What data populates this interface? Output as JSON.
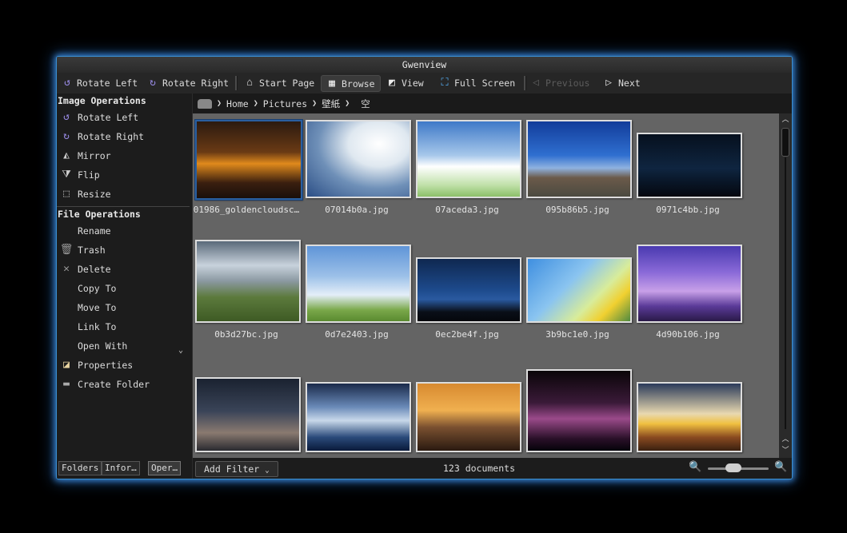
{
  "window": {
    "title": "Gwenview"
  },
  "toolbar": {
    "rotate_left": "Rotate Left",
    "rotate_right": "Rotate Right",
    "start_page": "Start Page",
    "browse": "Browse",
    "view": "View",
    "full_screen": "Full Screen",
    "previous": "Previous",
    "next": "Next"
  },
  "sidebar": {
    "image_ops_title": "Image Operations",
    "image_ops": [
      {
        "label": "Rotate Left",
        "icon": "rotate-left-icon"
      },
      {
        "label": "Rotate Right",
        "icon": "rotate-right-icon"
      },
      {
        "label": "Mirror",
        "icon": "mirror-icon"
      },
      {
        "label": "Flip",
        "icon": "flip-icon"
      },
      {
        "label": "Resize",
        "icon": "resize-icon"
      }
    ],
    "file_ops_title": "File Operations",
    "file_ops": [
      {
        "label": "Rename",
        "icon": ""
      },
      {
        "label": "Trash",
        "icon": "trash-icon"
      },
      {
        "label": "Delete",
        "icon": "delete-icon"
      },
      {
        "label": "Copy To",
        "icon": ""
      },
      {
        "label": "Move To",
        "icon": ""
      },
      {
        "label": "Link To",
        "icon": ""
      },
      {
        "label": "Open With",
        "icon": ""
      },
      {
        "label": "Properties",
        "icon": "properties-icon"
      },
      {
        "label": "Create Folder",
        "icon": "folder-icon"
      }
    ],
    "tabs": [
      "Folders",
      "Infor…",
      "Oper…"
    ],
    "selected_tab": "Oper…"
  },
  "breadcrumb": [
    "Home",
    "Pictures",
    "壁紙",
    "空"
  ],
  "thumbnails": [
    {
      "name": "01986_goldencloudsc…",
      "selected": true
    },
    {
      "name": "07014b0a.jpg"
    },
    {
      "name": "07aceda3.jpg"
    },
    {
      "name": "095b86b5.jpg"
    },
    {
      "name": "0971c4bb.jpg"
    },
    {
      "name": "0b3d27bc.jpg"
    },
    {
      "name": "0d7e2403.jpg"
    },
    {
      "name": "0ec2be4f.jpg"
    },
    {
      "name": "3b9bc1e0.jpg"
    },
    {
      "name": "4d90b106.jpg"
    },
    {
      "name": ""
    },
    {
      "name": ""
    },
    {
      "name": ""
    },
    {
      "name": ""
    },
    {
      "name": ""
    }
  ],
  "status": {
    "add_filter": "Add Filter",
    "count": "123 documents"
  },
  "colors": {
    "accent": "#3b8fd1",
    "window_glow": "#46a0ff",
    "selection": "#2a5f9f",
    "grid_bg": "#646464"
  }
}
